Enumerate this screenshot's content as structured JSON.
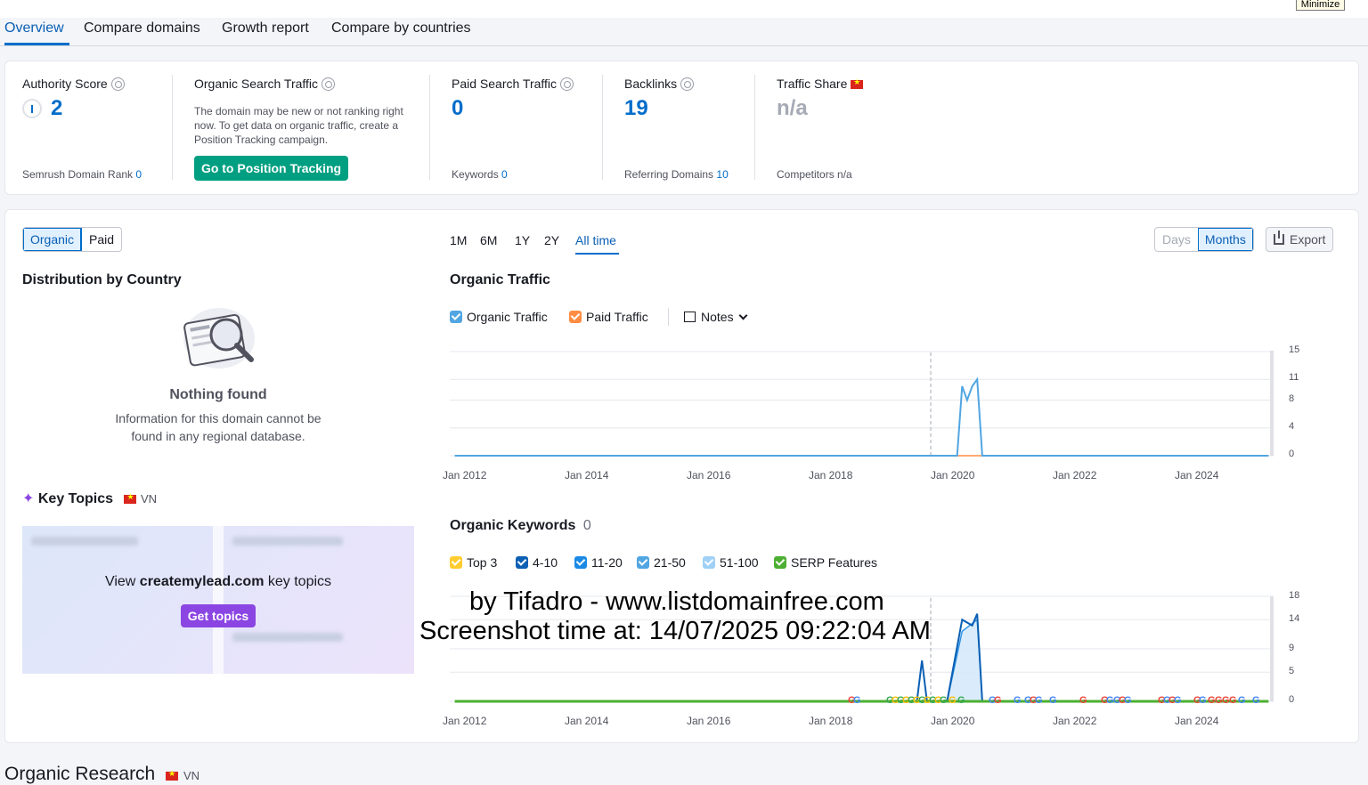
{
  "window": {
    "minimize_label": "Minimize"
  },
  "tabs": [
    {
      "label": "Overview",
      "active": true
    },
    {
      "label": "Compare domains"
    },
    {
      "label": "Growth report"
    },
    {
      "label": "Compare by countries"
    }
  ],
  "metrics": {
    "authority": {
      "title": "Authority Score",
      "value": "2",
      "sub_label": "Semrush Domain Rank",
      "sub_value": "0"
    },
    "organic": {
      "title": "Organic Search Traffic",
      "message": "The domain may be new or not ranking right now. To get data on organic traffic, create a Position Tracking campaign.",
      "button": "Go to Position Tracking"
    },
    "paid": {
      "title": "Paid Search Traffic",
      "value": "0",
      "sub_label": "Keywords",
      "sub_value": "0"
    },
    "backlinks": {
      "title": "Backlinks",
      "value": "19",
      "sub_label": "Referring Domains",
      "sub_value": "10"
    },
    "share": {
      "title": "Traffic Share",
      "value": "n/a",
      "sub_label": "Competitors",
      "sub_value": "n/a"
    }
  },
  "toggle": {
    "organic": "Organic",
    "paid": "Paid"
  },
  "ranges": [
    "1M",
    "6M",
    "1Y",
    "2Y",
    "All time"
  ],
  "view": {
    "days": "Days",
    "months": "Months",
    "export": "Export"
  },
  "distribution": {
    "title": "Distribution by Country",
    "empty_title": "Nothing found",
    "empty_text": "Information for this domain cannot be found in any regional database."
  },
  "key_topics": {
    "title": "Key Topics",
    "country": "VN",
    "view_prefix": "View",
    "domain": "createmylead.com",
    "view_suffix": "key topics",
    "button": "Get topics"
  },
  "traffic_chart": {
    "title": "Organic Traffic",
    "legend": {
      "organic": "Organic Traffic",
      "paid": "Paid Traffic",
      "notes": "Notes"
    }
  },
  "keywords_chart": {
    "title": "Organic Keywords",
    "count": "0",
    "legend": {
      "top3": "Top 3",
      "r4_10": "4-10",
      "r11_20": "11-20",
      "r21_50": "21-50",
      "r51_100": "51-100",
      "serp": "SERP Features"
    }
  },
  "colors": {
    "accent": "#006dca",
    "green": "#009f81",
    "purple": "#8b45e2",
    "organic_line": "#51a6e2",
    "serp_line": "#4caf32"
  },
  "chart_data": [
    {
      "type": "line",
      "title": "Organic Traffic",
      "x": [
        "Jan 2012",
        "Jan 2014",
        "Jan 2016",
        "Jan 2018",
        "Jan 2020",
        "Jan 2022",
        "Jan 2024"
      ],
      "yticks": [
        "15",
        "11",
        "8",
        "4",
        "0"
      ],
      "ylim": [
        0,
        15
      ],
      "series": [
        {
          "name": "Organic Traffic",
          "points": [
            [
              "2012-01",
              0
            ],
            [
              "2020-02",
              0
            ],
            [
              "2020-05",
              0
            ],
            [
              "2020-06",
              10
            ],
            [
              "2020-07",
              8
            ],
            [
              "2020-08",
              10
            ],
            [
              "2020-09",
              11
            ],
            [
              "2020-10",
              0
            ],
            [
              "2025-07",
              0
            ]
          ]
        },
        {
          "name": "Paid Traffic",
          "points": [
            [
              "2012-01",
              0
            ],
            [
              "2025-07",
              0
            ]
          ]
        }
      ]
    },
    {
      "type": "area",
      "title": "Organic Keywords",
      "x": [
        "Jan 2012",
        "Jan 2014",
        "Jan 2016",
        "Jan 2018",
        "Jan 2020",
        "Jan 2022",
        "Jan 2024"
      ],
      "yticks": [
        "18",
        "14",
        "9",
        "5",
        "0"
      ],
      "ylim": [
        0,
        18
      ],
      "series": [
        {
          "name": "SERP Features",
          "points": [
            [
              "2012-01",
              0
            ],
            [
              "2025-07",
              0
            ]
          ]
        },
        {
          "name": "4-10",
          "points": [
            [
              "2019-09",
              0
            ],
            [
              "2019-10",
              7
            ],
            [
              "2019-11",
              0
            ],
            [
              "2020-03",
              0
            ],
            [
              "2020-06",
              14
            ],
            [
              "2020-08",
              13
            ],
            [
              "2020-09",
              15
            ],
            [
              "2020-10",
              0
            ]
          ]
        },
        {
          "name": "11-20",
          "points": [
            [
              "2020-03",
              0
            ],
            [
              "2020-06",
              12
            ],
            [
              "2020-09",
              14
            ],
            [
              "2020-10",
              0
            ]
          ]
        }
      ]
    }
  ],
  "watermark": {
    "line1": "by Tifadro - www.listdomainfree.com",
    "line2": "Screenshot time at: 14/07/2025 09:22:04 AM"
  },
  "section": {
    "title": "Organic Research",
    "country": "VN"
  }
}
